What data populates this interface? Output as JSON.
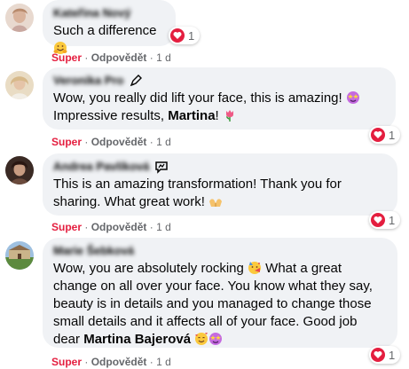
{
  "comments": [
    {
      "author": "Kateřina Nový",
      "text": "Such a difference",
      "reaction_count": "1",
      "actions": {
        "reaction": "Super",
        "reply": "Odpovědět",
        "time": "1 d"
      }
    },
    {
      "author": "Veronika Pro",
      "text_parts": [
        "Wow, you really did lift your face, this is amazing! ",
        "Impressive results, ",
        "Martina",
        "! "
      ],
      "reaction_count": "1",
      "actions": {
        "reaction": "Super",
        "reply": "Odpovědět",
        "time": "1 d"
      }
    },
    {
      "author": "Andrea Pavlíková",
      "text_parts": [
        "This is an amazing transformation! Thank you for sharing. What great work! "
      ],
      "reaction_count": "1",
      "actions": {
        "reaction": "Super",
        "reply": "Odpovědět",
        "time": "1 d"
      }
    },
    {
      "author": "Marie Šebková",
      "text_parts": [
        "Wow, you are absolutely rocking ",
        " What a great change on all over your face. You know what they say, beauty is in details and you managed to change those small details and it affects all of your face. Good job dear ",
        "Martina Bajerová",
        " "
      ],
      "reaction_count": "1",
      "actions": {
        "reaction": "Super",
        "reply": "Odpovědět",
        "time": "1 d"
      }
    }
  ],
  "colors": {
    "bubble": "#f0f2f5",
    "super": "#e41e3f",
    "meta": "#65676b",
    "heart": "#e41e3f"
  },
  "icons": [
    "smiling-face-with-open-hands-emoji",
    "star-struck-emoji",
    "tulip-emoji",
    "palms-up-together-emoji",
    "face-with-party-horn-emoji",
    "smiling-face-with-hearts-emoji",
    "heart-reaction-icon",
    "pen-badge-icon",
    "chat-badge-icon"
  ]
}
